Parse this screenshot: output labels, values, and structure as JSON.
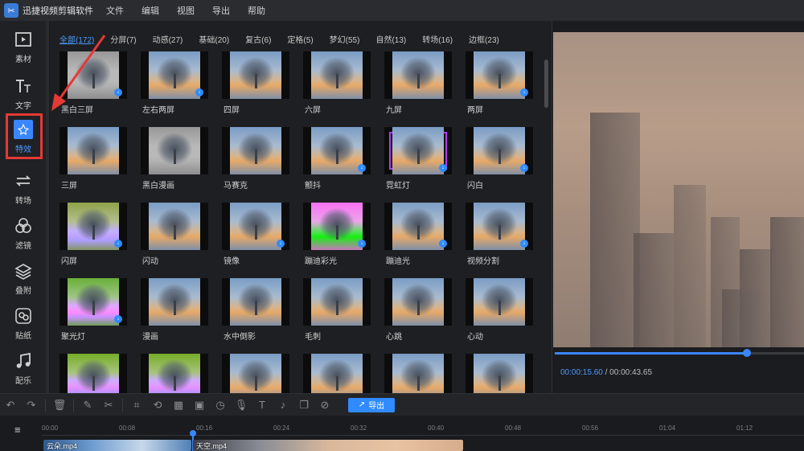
{
  "app": {
    "name": "迅捷视频剪辑软件"
  },
  "menu": [
    "文件",
    "编辑",
    "视图",
    "导出",
    "帮助"
  ],
  "nav": [
    {
      "label": "素材",
      "icon": "media-icon"
    },
    {
      "label": "文字",
      "icon": "text-icon"
    },
    {
      "label": "特效",
      "icon": "effects-icon",
      "active": true
    },
    {
      "label": "转场",
      "icon": "transition-icon"
    },
    {
      "label": "滤镜",
      "icon": "filter-icon"
    },
    {
      "label": "叠附",
      "icon": "overlay-icon"
    },
    {
      "label": "贴纸",
      "icon": "sticker-icon"
    },
    {
      "label": "配乐",
      "icon": "music-icon"
    }
  ],
  "categories": [
    "全部(172)",
    "分屏(7)",
    "动感(27)",
    "基础(20)",
    "复古(6)",
    "定格(5)",
    "梦幻(55)",
    "自然(13)",
    "转场(16)",
    "边框(23)"
  ],
  "effects": [
    "黑白三屏",
    "左右两屏",
    "四屏",
    "六屏",
    "九屏",
    "两屏",
    "三屏",
    "黑白漫画",
    "马赛克",
    "颤抖",
    "霓虹灯",
    "闪白",
    "闪屏",
    "闪动",
    "镜像",
    "蹦迪彩光",
    "蹦迪光",
    "视频分割",
    "聚光灯",
    "漫画",
    "水中倒影",
    "毛刺",
    "心跳",
    "心动",
    "",
    "",
    "",
    "",
    "",
    ""
  ],
  "player": {
    "current": "00:00:15.60",
    "separator": " / ",
    "total": "00:00:43.65",
    "progress": 0.77
  },
  "toolbar": {
    "export_label": "导出"
  },
  "timeline": {
    "ticks": [
      "00:00",
      "00:08",
      "00:16",
      "00:24",
      "00:32",
      "00:40",
      "00:48",
      "00:56",
      "01:04",
      "01:12"
    ],
    "clips": [
      {
        "label": "云朵.mp4"
      },
      {
        "label": "天空.mp4"
      }
    ]
  },
  "colors": {
    "accent": "#3a86ff",
    "highlight_box": "#e53935",
    "selected_effect_border": "#b23cf0"
  }
}
